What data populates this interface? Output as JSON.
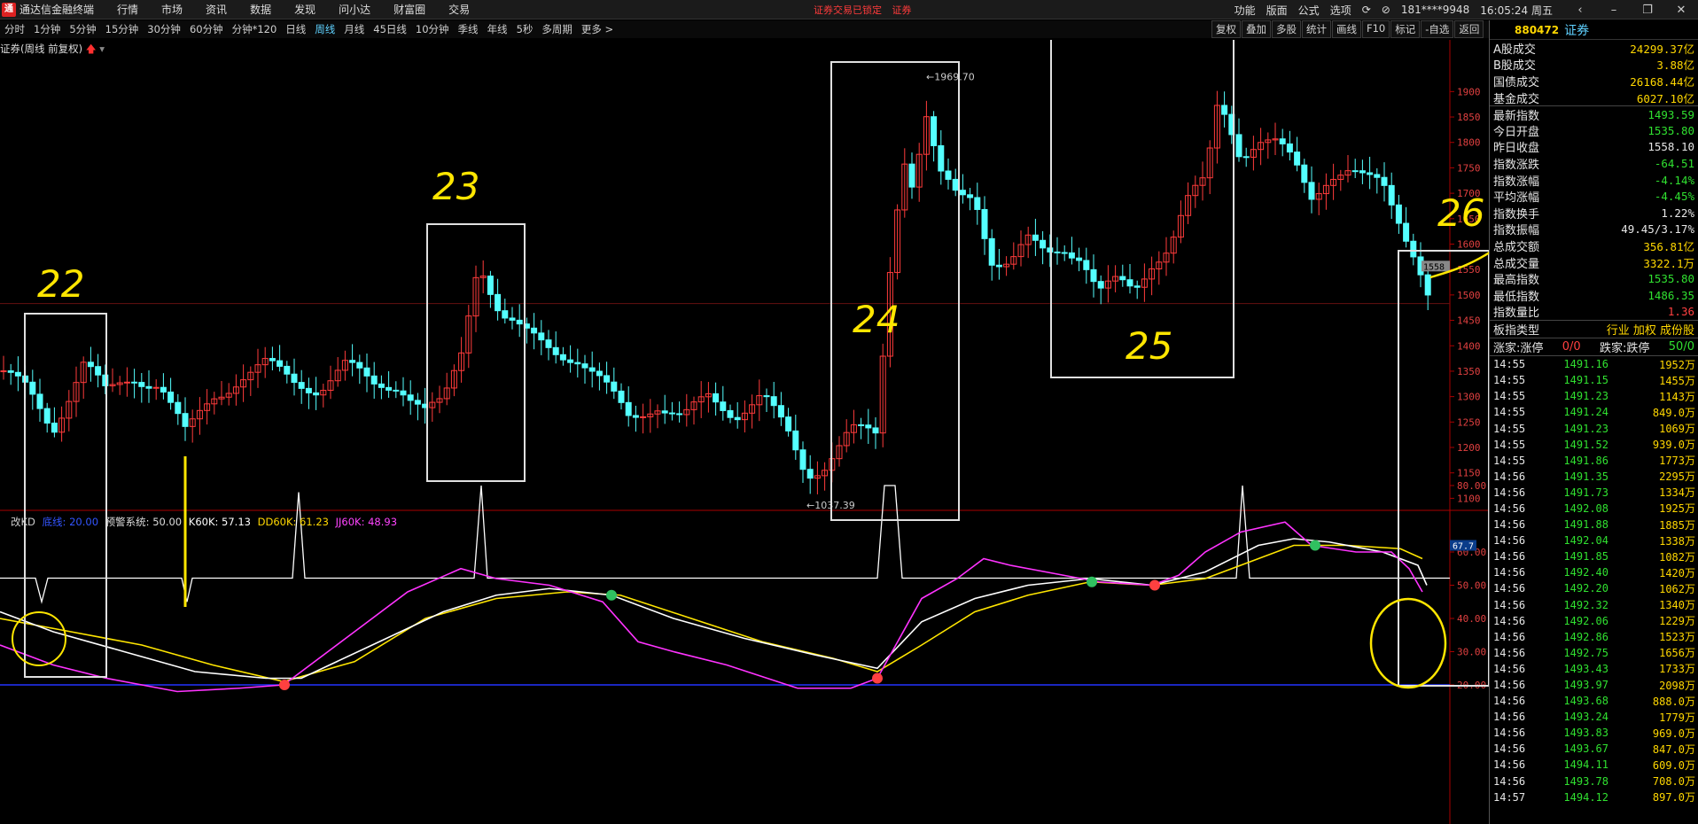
{
  "app": {
    "title": "通达信金融终端",
    "menus": [
      "行情",
      "市场",
      "资讯",
      "数据",
      "发现",
      "问小达",
      "财富圈",
      "交易"
    ],
    "alerts": [
      "证券交易已锁定",
      "证券"
    ],
    "right_menus": [
      "功能",
      "版面",
      "公式",
      "选项"
    ],
    "account": "181****9948",
    "clock": "16:05:24 周五"
  },
  "periods": [
    "分时",
    "1分钟",
    "5分钟",
    "15分钟",
    "30分钟",
    "60分钟",
    "分钟*120",
    "日线",
    "周线",
    "月线",
    "45日线",
    "10分钟",
    "季线",
    "年线",
    "5秒",
    "多周期",
    "更多 >"
  ],
  "active_period": "周线",
  "tools": [
    "复权",
    "叠加",
    "多股",
    "统计",
    "画线",
    "F10",
    "标记",
    "-自选",
    "返回"
  ],
  "chart": {
    "title": "证券(周线 前复权)",
    "high_label": "1969.70",
    "low_label": "1037.39",
    "last_tag": "1558",
    "kd_tag": "67.7",
    "indicator": {
      "name": "改KD",
      "p1": "底线: 20.00",
      "p2": "预警系统: 50.00",
      "k60": "K60K: 57.13",
      "dd60": "DD60K: 61.23",
      "jj60": "JJ60K: 48.93"
    },
    "annotations": [
      "22",
      "23",
      "24",
      "25",
      "26"
    ]
  },
  "chart_data": {
    "type": "candlestick",
    "price_axis_ticks": [
      1900,
      1850,
      1800,
      1750,
      1700,
      1650,
      1600,
      1550,
      1500,
      1450,
      1400,
      1350,
      1300,
      1250,
      1200,
      1150,
      1100
    ],
    "indicator_axis_ticks": [
      80.0,
      60.0,
      50.0,
      40.0,
      30.0,
      20.0
    ],
    "price_range": [
      1037.39,
      1969.7
    ],
    "last_close": 1491.16
  },
  "quote": {
    "code": "880472",
    "name": "证券",
    "rows": [
      {
        "label": "A股成交",
        "value": "24299.37亿",
        "cls": "yel"
      },
      {
        "label": "B股成交",
        "value": "3.88亿",
        "cls": "yel"
      },
      {
        "label": "国债成交",
        "value": "26168.44亿",
        "cls": "yel"
      },
      {
        "label": "基金成交",
        "value": "6027.10亿",
        "cls": "yel"
      },
      {
        "label": "最新指数",
        "value": "1493.59",
        "cls": "down"
      },
      {
        "label": "今日开盘",
        "value": "1535.80",
        "cls": "down"
      },
      {
        "label": "昨日收盘",
        "value": "1558.10",
        "cls": ""
      },
      {
        "label": "指数涨跌",
        "value": "-64.51",
        "cls": "down"
      },
      {
        "label": "指数涨幅",
        "value": "-4.14%",
        "cls": "down"
      },
      {
        "label": "平均涨幅",
        "value": "-4.45%",
        "cls": "down"
      },
      {
        "label": "指数换手",
        "value": "1.22%",
        "cls": ""
      },
      {
        "label": "指数振幅",
        "value": "49.45/3.17%",
        "cls": ""
      },
      {
        "label": "总成交额",
        "value": "356.81亿",
        "cls": "yel"
      },
      {
        "label": "总成交量",
        "value": "3322.1万",
        "cls": "yel"
      },
      {
        "label": "最高指数",
        "value": "1535.80",
        "cls": "down"
      },
      {
        "label": "最低指数",
        "value": "1486.35",
        "cls": "down"
      },
      {
        "label": "指数量比",
        "value": "1.36",
        "cls": "up"
      }
    ],
    "type_label": "板指类型",
    "type_links": "行业 加权 成份股",
    "updown_label1": "涨家:涨停",
    "updown_val1": "0/0",
    "updown_label2": "跌家:跌停",
    "updown_val2": "50/0",
    "ticks": [
      [
        "14:55",
        "1491.16",
        "1952万"
      ],
      [
        "14:55",
        "1491.15",
        "1455万"
      ],
      [
        "14:55",
        "1491.23",
        "1143万"
      ],
      [
        "14:55",
        "1491.24",
        "849.0万"
      ],
      [
        "14:55",
        "1491.23",
        "1069万"
      ],
      [
        "14:55",
        "1491.52",
        "939.0万"
      ],
      [
        "14:55",
        "1491.86",
        "1773万"
      ],
      [
        "14:56",
        "1491.35",
        "2295万"
      ],
      [
        "14:56",
        "1491.73",
        "1334万"
      ],
      [
        "14:56",
        "1492.08",
        "1925万"
      ],
      [
        "14:56",
        "1491.88",
        "1885万"
      ],
      [
        "14:56",
        "1492.04",
        "1338万"
      ],
      [
        "14:56",
        "1491.85",
        "1082万"
      ],
      [
        "14:56",
        "1492.40",
        "1420万"
      ],
      [
        "14:56",
        "1492.20",
        "1062万"
      ],
      [
        "14:56",
        "1492.32",
        "1340万"
      ],
      [
        "14:56",
        "1492.06",
        "1229万"
      ],
      [
        "14:56",
        "1492.86",
        "1523万"
      ],
      [
        "14:56",
        "1492.75",
        "1656万"
      ],
      [
        "14:56",
        "1493.43",
        "1733万"
      ],
      [
        "14:56",
        "1493.97",
        "2098万"
      ],
      [
        "14:56",
        "1493.68",
        "888.0万"
      ],
      [
        "14:56",
        "1493.24",
        "1779万"
      ],
      [
        "14:56",
        "1493.83",
        "969.0万"
      ],
      [
        "14:56",
        "1493.67",
        "847.0万"
      ],
      [
        "14:56",
        "1494.11",
        "609.0万"
      ],
      [
        "14:56",
        "1493.78",
        "708.0万"
      ],
      [
        "14:57",
        "1494.12",
        "897.0万"
      ]
    ]
  }
}
